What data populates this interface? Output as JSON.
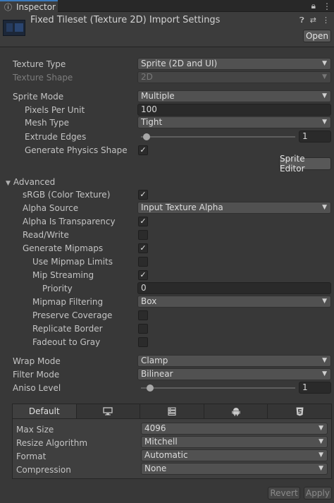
{
  "window": {
    "tab_label": "Inspector",
    "tab_icon": "info-icon"
  },
  "header": {
    "title": "Fixed Tileset (Texture 2D) Import Settings",
    "open_label": "Open",
    "icons": [
      "help-icon",
      "presets-icon",
      "more-icon"
    ]
  },
  "fields": {
    "texture_type": {
      "label": "Texture Type",
      "value": "Sprite (2D and UI)"
    },
    "texture_shape": {
      "label": "Texture Shape",
      "value": "2D"
    },
    "sprite_mode": {
      "label": "Sprite Mode",
      "value": "Multiple"
    },
    "pixels_per_unit": {
      "label": "Pixels Per Unit",
      "value": "100"
    },
    "mesh_type": {
      "label": "Mesh Type",
      "value": "Tight"
    },
    "extrude_edges": {
      "label": "Extrude Edges",
      "value": "1",
      "slider_fraction": 0.03
    },
    "generate_physics_shape": {
      "label": "Generate Physics Shape",
      "checked": true
    },
    "sprite_editor_label": "Sprite Editor"
  },
  "advanced": {
    "label": "Advanced",
    "srgb": {
      "label": "sRGB (Color Texture)",
      "checked": true
    },
    "alpha_source": {
      "label": "Alpha Source",
      "value": "Input Texture Alpha"
    },
    "alpha_is_transparency": {
      "label": "Alpha Is Transparency",
      "checked": true
    },
    "read_write": {
      "label": "Read/Write",
      "checked": false
    },
    "generate_mipmaps": {
      "label": "Generate Mipmaps",
      "checked": true
    },
    "use_mipmap_limits": {
      "label": "Use Mipmap Limits",
      "checked": false
    },
    "mip_streaming": {
      "label": "Mip Streaming",
      "checked": true
    },
    "priority": {
      "label": "Priority",
      "value": "0"
    },
    "mipmap_filtering": {
      "label": "Mipmap Filtering",
      "value": "Box"
    },
    "preserve_coverage": {
      "label": "Preserve Coverage",
      "checked": false
    },
    "replicate_border": {
      "label": "Replicate Border",
      "checked": false
    },
    "fadeout_to_gray": {
      "label": "Fadeout to Gray",
      "checked": false
    }
  },
  "sampling": {
    "wrap_mode": {
      "label": "Wrap Mode",
      "value": "Clamp"
    },
    "filter_mode": {
      "label": "Filter Mode",
      "value": "Bilinear"
    },
    "aniso_level": {
      "label": "Aniso Level",
      "value": "1",
      "slider_fraction": 0.07
    }
  },
  "platform": {
    "tabs": [
      {
        "label": "Default",
        "icon": ""
      },
      {
        "label": "",
        "icon": "monitor-icon"
      },
      {
        "label": "",
        "icon": "server-icon"
      },
      {
        "label": "",
        "icon": "android-icon"
      },
      {
        "label": "",
        "icon": "html5-icon"
      }
    ],
    "max_size": {
      "label": "Max Size",
      "value": "4096"
    },
    "resize_algorithm": {
      "label": "Resize Algorithm",
      "value": "Mitchell"
    },
    "format": {
      "label": "Format",
      "value": "Automatic"
    },
    "compression": {
      "label": "Compression",
      "value": "None"
    }
  },
  "footer": {
    "revert_label": "Revert",
    "apply_label": "Apply"
  }
}
